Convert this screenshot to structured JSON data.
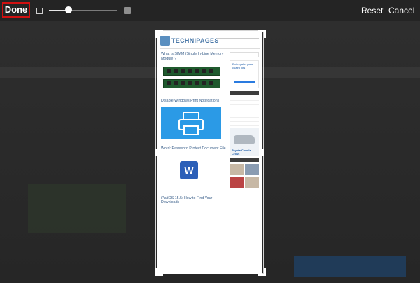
{
  "toolbar": {
    "done_label": "Done",
    "reset_label": "Reset",
    "cancel_label": "Cancel",
    "zoom_fraction": 0.33
  },
  "webpage": {
    "brand": "TECHNIPAGES",
    "articles": [
      {
        "title": "What Is SIMM (Single In-Line Memory Module)?"
      },
      {
        "title": "Disable Windows Print Notifications"
      },
      {
        "title": "Word: Password Protect Document File"
      },
      {
        "title": "iPadOS 15.5: How to Find Your Downloads"
      }
    ],
    "sidebar_ad_text": "Dni regalos para cuatro kits",
    "car_ad_name": "Toyota Corolla Cross"
  }
}
